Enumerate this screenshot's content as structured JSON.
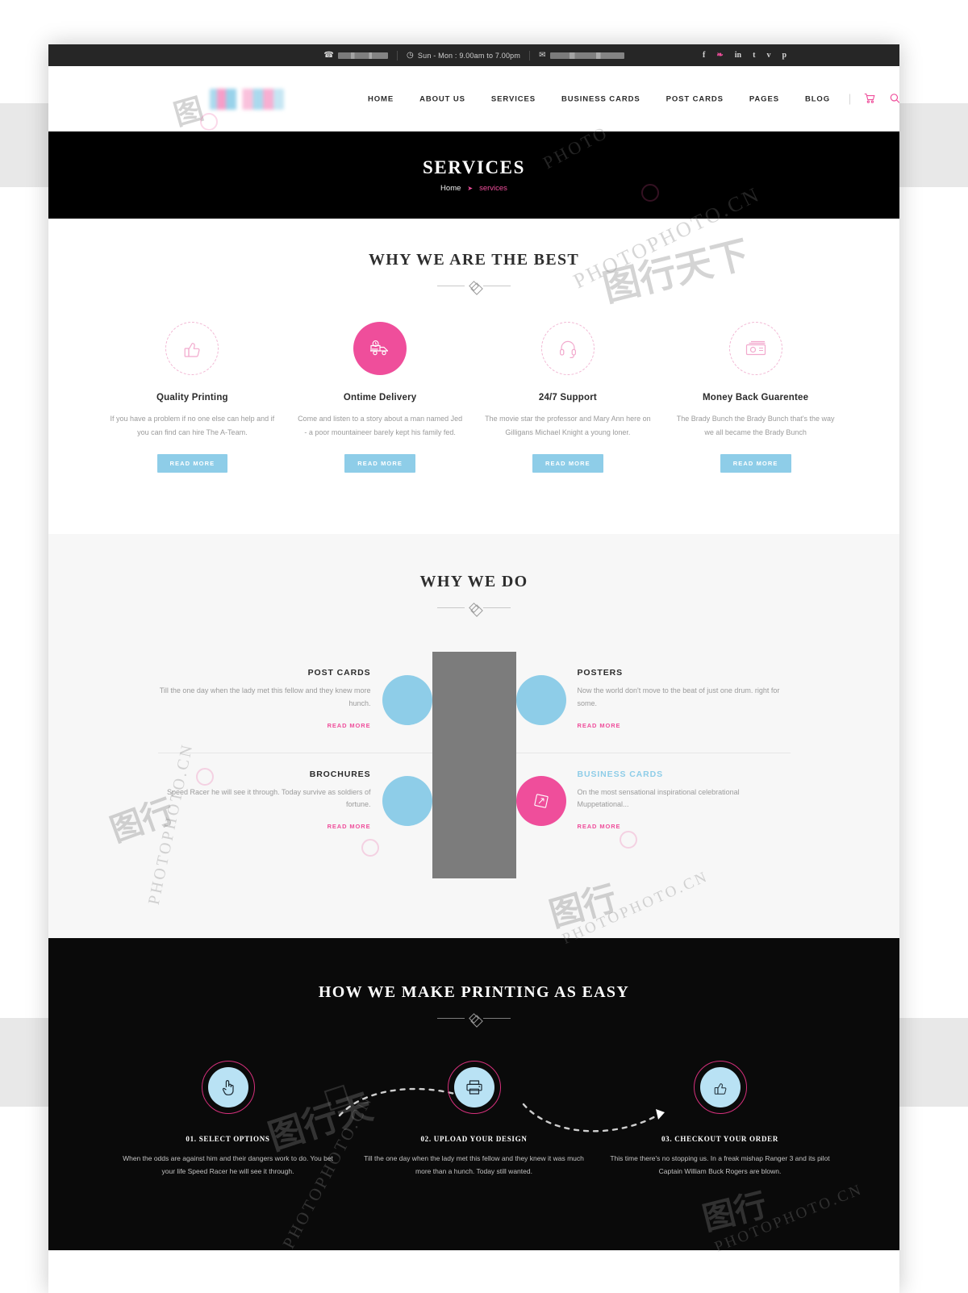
{
  "topbar": {
    "phone_icon": "phone-icon",
    "phone_value": "",
    "clock_icon": "clock-icon",
    "hours": "Sun - Mon : 9.00am to 7.00pm",
    "mail_icon": "envelope-icon",
    "email_value": "",
    "socials": [
      {
        "name": "facebook",
        "glyph": "f"
      },
      {
        "name": "twitter",
        "glyph": "❧"
      },
      {
        "name": "linkedin",
        "glyph": "in"
      },
      {
        "name": "tumblr",
        "glyph": "t"
      },
      {
        "name": "vimeo",
        "glyph": "v"
      },
      {
        "name": "pinterest",
        "glyph": "p"
      }
    ]
  },
  "header": {
    "logo_alt": "site-logo",
    "nav": [
      {
        "label": "HOME"
      },
      {
        "label": "ABOUT US"
      },
      {
        "label": "SERVICES"
      },
      {
        "label": "BUSINESS CARDS"
      },
      {
        "label": "POST CARDS"
      },
      {
        "label": "PAGES"
      },
      {
        "label": "BLOG"
      }
    ],
    "cart_icon": "shopping-cart-icon",
    "search_icon": "search-icon"
  },
  "banner": {
    "title": "SERVICES",
    "breadcrumb_home": "Home",
    "breadcrumb_arrow": "➤",
    "breadcrumb_current": "services"
  },
  "best": {
    "heading": "WHY WE ARE THE BEST",
    "features": [
      {
        "icon": "thumbs-up-icon",
        "title": "Quality Printing",
        "text": "If you have a problem if no one else can help and if you can find can hire The A-Team.",
        "button": "READ MORE",
        "highlighted": false
      },
      {
        "icon": "delivery-truck-icon",
        "title": "Ontime Delivery",
        "text": "Come and listen to a story about a man named Jed - a poor mountaineer barely kept his family fed.",
        "button": "READ MORE",
        "highlighted": true
      },
      {
        "icon": "headset-icon",
        "title": "24/7 Support",
        "text": "The movie star the professor and Mary Ann here on Gilligans Michael Knight a young loner.",
        "button": "READ MORE",
        "highlighted": false
      },
      {
        "icon": "money-icon",
        "title": "Money Back Guarentee",
        "text": "The Brady Bunch the Brady Bunch that's the way we all became the Brady Bunch",
        "button": "READ MORE",
        "highlighted": false
      }
    ]
  },
  "whydo": {
    "heading": "WHY WE DO",
    "center_image_alt": "printing-showcase-image",
    "left": [
      {
        "icon": "postcard-icon",
        "title": "POST CARDS",
        "text": "Till the one day when the lady met this fellow and they knew more hunch.",
        "more": "READ MORE",
        "active": false
      },
      {
        "icon": "brochure-icon",
        "title": "BROCHURES",
        "text": "Speed Racer he will see it through. Today survive as soldiers of fortune.",
        "more": "READ MORE",
        "active": false
      }
    ],
    "right": [
      {
        "icon": "poster-icon",
        "title": "POSTERS",
        "text": "Now the world don't move to the beat of just one drum.  right for some.",
        "more": "READ MORE",
        "active": false
      },
      {
        "icon": "business-card-icon",
        "title": "BUSINESS CARDS",
        "text": "On the most sensational inspirational celebrational Muppetational...",
        "more": "READ MORE",
        "active": true
      }
    ]
  },
  "howeasy": {
    "heading": "HOW WE MAKE PRINTING AS EASY",
    "steps": [
      {
        "icon": "pointer-hand-icon",
        "title": "01. SELECT OPTIONS",
        "text": "When the odds are against him and their dangers work to do. You bet your life Speed Racer he will see it through."
      },
      {
        "icon": "printer-icon",
        "title": "02. UPLOAD YOUR DESIGN",
        "text": "Till the one day when the lady met this fellow and they knew it was much more than a hunch. Today still wanted."
      },
      {
        "icon": "thumbs-up-icon",
        "title": "03. CHECKOUT YOUR ORDER",
        "text": "This time there's no stopping us. In a freak mishap Ranger 3 and its pilot Captain William Buck Rogers are blown."
      }
    ]
  },
  "colors": {
    "pink": "#ef4e9b",
    "blue": "#8ecde8",
    "dark": "#0a0a0a",
    "topbar": "#262626",
    "section_bg": "#f7f7f7"
  },
  "watermark": {
    "text_en": "PHOTOPHOTO.CN",
    "text_cn": "图行天下"
  }
}
